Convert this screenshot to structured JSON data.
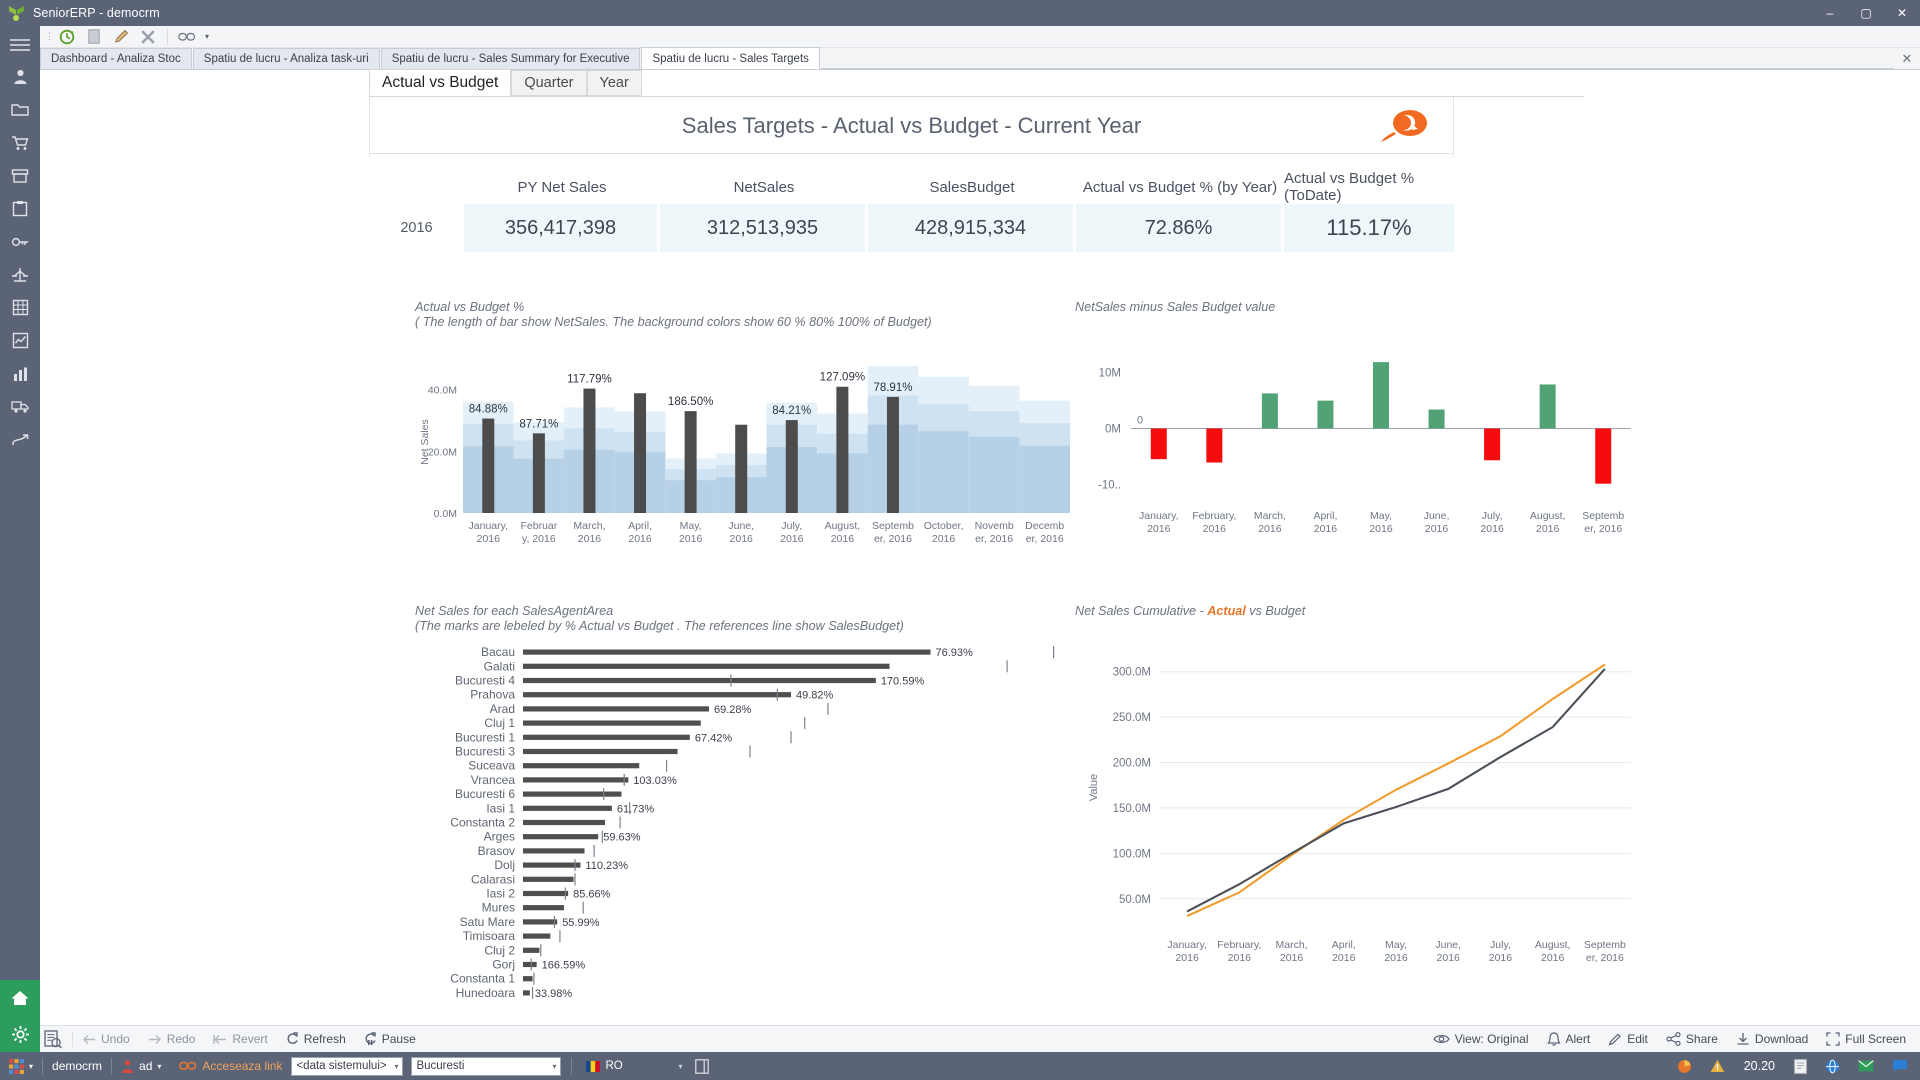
{
  "window": {
    "title": "SeniorERP - democrm",
    "minimize": "–",
    "maximize": "▢",
    "close": "✕"
  },
  "toolbar": {
    "refresh_icon": "refresh-circle-icon",
    "new_icon": "new-document-icon",
    "edit_icon": "pencil-icon",
    "delete_icon": "delete-x-icon",
    "link_icon": "link-icon",
    "more_caret": "▾"
  },
  "rail": {
    "items": [
      {
        "name": "menu-hamburger-icon"
      },
      {
        "name": "user-icon"
      },
      {
        "name": "folder-open-icon"
      },
      {
        "name": "cart-icon"
      },
      {
        "name": "archive-icon"
      },
      {
        "name": "clipboard-icon"
      },
      {
        "name": "key-icon"
      },
      {
        "name": "scales-icon"
      },
      {
        "name": "grid-icon"
      },
      {
        "name": "trend-chart-icon"
      },
      {
        "name": "bar-chart-icon"
      },
      {
        "name": "truck-icon"
      },
      {
        "name": "flow-icon"
      }
    ],
    "bottom": [
      {
        "name": "home-icon"
      },
      {
        "name": "settings-gear-icon"
      },
      {
        "name": "apps-grid-icon"
      }
    ]
  },
  "workspace_tabs": {
    "items": [
      {
        "label": "Dashboard - Analiza Stoc",
        "active": false
      },
      {
        "label": "Spatiu de lucru - Analiza task-uri",
        "active": false
      },
      {
        "label": "Spatiu de lucru - Sales Summary for Executive",
        "active": false
      },
      {
        "label": "Spatiu de lucru - Sales Targets",
        "active": true
      }
    ],
    "close_label": "✕"
  },
  "dashboard_tabs": {
    "items": [
      {
        "label": "Actual vs Budget",
        "active": true
      },
      {
        "label": "Quarter",
        "active": false
      },
      {
        "label": "Year",
        "active": false
      }
    ]
  },
  "dashboard": {
    "title": "Sales Targets - Actual vs Budget - Current Year",
    "logo_name": "orange-comet-logo"
  },
  "kpi": {
    "headers": [
      "",
      "PY Net Sales",
      "NetSales",
      "SalesBudget",
      "Actual vs Budget % (by Year)",
      "Actual vs Budget % (ToDate)"
    ],
    "year": "2016",
    "values": [
      "356,417,398",
      "312,513,935",
      "428,915,334",
      "72.86%",
      "115.17%"
    ]
  },
  "panels": {
    "actual_vs_budget": {
      "title": "Actual vs Budget %",
      "subtitle": "( The length of bar show NetSales. The background colors show 60 % 80% 100% of Budget)"
    },
    "netsales_minus_budget": {
      "title": "NetSales minus Sales Budget value"
    },
    "agent_area": {
      "title": "Net Sales for each SalesAgentArea",
      "subtitle": "(The marks are lebeled by % Actual vs Budget . The references line show SalesBudget)"
    },
    "cumulative": {
      "title_pre": "Net Sales Cumulative - ",
      "title_accent": "Actual",
      "title_post": " vs Budget"
    }
  },
  "chart_data": [
    {
      "id": "actual_vs_budget",
      "type": "bar",
      "title": "Actual vs Budget %",
      "subtitle": "( The length of bar show NetSales. The background colors show 60 % 80% 100% of Budget)",
      "ylabel": "Net Sales",
      "ylim": [
        0,
        46000000
      ],
      "yticks": [
        0,
        20000000,
        40000000
      ],
      "ytick_labels": [
        "0.0M",
        "20.0M",
        "40.0M"
      ],
      "categories": [
        "January, 2016",
        "February, 2016",
        "March, 2016",
        "April, 2016",
        "May, 2016",
        "June, 2016",
        "July, 2016",
        "August, 2016",
        "September, 2016",
        "October, 2016",
        "November, 2016",
        "December, 2016"
      ],
      "values": [
        30600000,
        25800000,
        40300000,
        38800000,
        33000000,
        28600000,
        30100000,
        40900000,
        37600000,
        0,
        0,
        0
      ],
      "data_labels": [
        "84.88%",
        "87.71%",
        "117.79%",
        "",
        "186.50%",
        "",
        "84.21%",
        "127.09%",
        "78.91%",
        "",
        "",
        ""
      ],
      "budget_bands": [
        {
          "month": "January, 2016",
          "b60": 21600000,
          "b80": 28800000,
          "b100": 36000000
        },
        {
          "month": "February, 2016",
          "b60": 17600000,
          "b80": 23500000,
          "b100": 29400000
        },
        {
          "month": "March, 2016",
          "b60": 20500000,
          "b80": 27400000,
          "b100": 34200000
        },
        {
          "month": "April, 2016",
          "b60": 19700000,
          "b80": 26300000,
          "b100": 32900000
        },
        {
          "month": "May, 2016",
          "b60": 10600000,
          "b80": 14200000,
          "b100": 17700000
        },
        {
          "month": "June, 2016",
          "b60": 11600000,
          "b80": 15500000,
          "b100": 19300000
        },
        {
          "month": "July, 2016",
          "b60": 21400000,
          "b80": 28600000,
          "b100": 35700000
        },
        {
          "month": "August, 2016",
          "b60": 19300000,
          "b80": 25700000,
          "b100": 32200000
        },
        {
          "month": "September, 2016",
          "b60": 28600000,
          "b80": 38100000,
          "b100": 47600000
        },
        {
          "month": "October, 2016",
          "b60": 26500000,
          "b80": 35300000,
          "b100": 44100000
        },
        {
          "month": "November, 2016",
          "b60": 24700000,
          "b80": 33000000,
          "b100": 41200000
        },
        {
          "month": "December, 2016",
          "b60": 21800000,
          "b80": 29100000,
          "b100": 36400000
        }
      ],
      "bar_color": "#4c4c4c",
      "band_colors": [
        "#e3f0fa",
        "#cfe2f2",
        "#aec9e2"
      ]
    },
    {
      "id": "netsales_minus_budget",
      "type": "bar",
      "title": "NetSales minus Sales Budget value",
      "yticks": [
        10000000,
        0,
        -10000000
      ],
      "ytick_labels": [
        "10M",
        "0M",
        "-10.."
      ],
      "zero_label": "0",
      "ylim": [
        -13000000,
        13000000
      ],
      "categories": [
        "January, 2016",
        "February, 2016",
        "March, 2016",
        "April, 2016",
        "May, 2016",
        "June, 2016",
        "July, 2016",
        "August, 2016",
        "September, 2016"
      ],
      "values": [
        -5500000,
        -6100000,
        6300000,
        5000000,
        11900000,
        3400000,
        -5700000,
        7900000,
        -9900000
      ],
      "positive_color": "#51a375",
      "negative_color": "#f50d0d"
    },
    {
      "id": "agent_area",
      "type": "bar",
      "orientation": "horizontal",
      "title": "Net Sales for each SalesAgentArea",
      "subtitle": "(The marks are lebeled by % Actual vs Budget . The references line show SalesBudget)",
      "categories": [
        "Bacau",
        "Galati",
        "Bucuresti 4",
        "Prahova",
        "Arad",
        "Cluj 1",
        "Bucuresti 1",
        "Bucuresti 3",
        "Suceava",
        "Vrancea",
        "Bucuresti 6",
        "Iasi 1",
        "Constanta 2",
        "Arges",
        "Brasov",
        "Dolj",
        "Calarasi",
        "Iasi 2",
        "Mures",
        "Satu Mare",
        "Timisoara",
        "Cluj 2",
        "Gorj",
        "Constanta 1",
        "Hunedoara"
      ],
      "values": [
        298,
        268,
        258,
        196,
        136,
        130,
        122,
        113,
        85,
        77,
        72,
        65,
        60,
        55,
        45,
        42,
        37,
        33,
        30,
        25,
        20,
        12,
        10,
        7,
        5
      ],
      "reference_values": [
        388,
        354,
        152,
        186,
        223,
        206,
        196,
        166,
        105,
        74,
        59,
        78,
        71,
        58,
        52,
        38,
        38,
        31,
        44,
        23,
        27,
        13,
        6,
        8,
        7
      ],
      "data_labels": [
        "76.93%",
        "",
        "170.59%",
        "49.82%",
        "69.28%",
        "",
        "67.42%",
        "",
        "",
        "103.03%",
        "",
        "61.73%",
        "",
        "59.63%",
        "",
        "110.23%",
        "",
        "85.66%",
        "",
        "55.99%",
        "",
        "",
        "166.59%",
        "",
        "33.98%"
      ],
      "bar_color": "#4f4f4f"
    },
    {
      "id": "cumulative",
      "type": "line",
      "title": "Net Sales Cumulative - Actual vs Budget",
      "ylabel": "Value",
      "yticks": [
        50000000,
        100000000,
        150000000,
        200000000,
        250000000,
        300000000
      ],
      "ytick_labels": [
        "50.0M",
        "100.0M",
        "150.0M",
        "200.0M",
        "250.0M",
        "300.0M"
      ],
      "ylim": [
        20000000,
        325000000
      ],
      "categories": [
        "January, 2016",
        "February, 2016",
        "March, 2016",
        "April, 2016",
        "May, 2016",
        "June, 2016",
        "July, 2016",
        "August, 2016",
        "September, 2016"
      ],
      "series": [
        {
          "name": "Actual",
          "color": "#f39c2e",
          "values": [
            31000000,
            57000000,
            98000000,
            137000000,
            170000000,
            199000000,
            229000000,
            270000000,
            308000000
          ]
        },
        {
          "name": "Budget",
          "color": "#4a5058",
          "values": [
            36000000,
            66000000,
            100000000,
            133000000,
            151000000,
            171000000,
            206000000,
            239000000,
            303000000
          ]
        }
      ]
    }
  ],
  "commandbar": {
    "items": [
      {
        "label": "Undo",
        "icon": "arrow-left-icon",
        "enabled": false
      },
      {
        "label": "Redo",
        "icon": "arrow-right-icon",
        "enabled": false
      },
      {
        "label": "Revert",
        "icon": "revert-icon",
        "enabled": false
      },
      {
        "label": "Refresh",
        "icon": "refresh-icon",
        "enabled": true
      },
      {
        "label": "Pause",
        "icon": "pause-icon",
        "enabled": true
      }
    ],
    "right_items": [
      {
        "label": "View: Original",
        "icon": "view-icon"
      },
      {
        "label": "Alert",
        "icon": "bell-icon"
      },
      {
        "label": "Edit",
        "icon": "pencil-icon"
      },
      {
        "label": "Share",
        "icon": "share-icon"
      },
      {
        "label": "Download",
        "icon": "download-icon"
      },
      {
        "label": "Full Screen",
        "icon": "fullscreen-icon"
      }
    ]
  },
  "statusbar": {
    "apps_icon": "apps-grid-icon",
    "apps_caret": "▾",
    "database": "democrm",
    "user_icon": "user-icon",
    "user": "ad",
    "user_caret": "▾",
    "link_icon": "link-icon",
    "link_label": "Acceseaza link",
    "date_value": "<data sistemului>",
    "location_value": "Bucuresti",
    "flag_icon": "romania-flag-icon",
    "language": "RO",
    "layout_icon": "panel-layout-icon",
    "tray": [
      {
        "name": "pie-chart-icon"
      },
      {
        "name": "warning-icon"
      }
    ],
    "clock": "20.20",
    "tray_right": [
      {
        "name": "document-icon"
      },
      {
        "name": "globe-icon"
      },
      {
        "name": "mail-icon"
      },
      {
        "name": "chat-icon"
      }
    ]
  }
}
